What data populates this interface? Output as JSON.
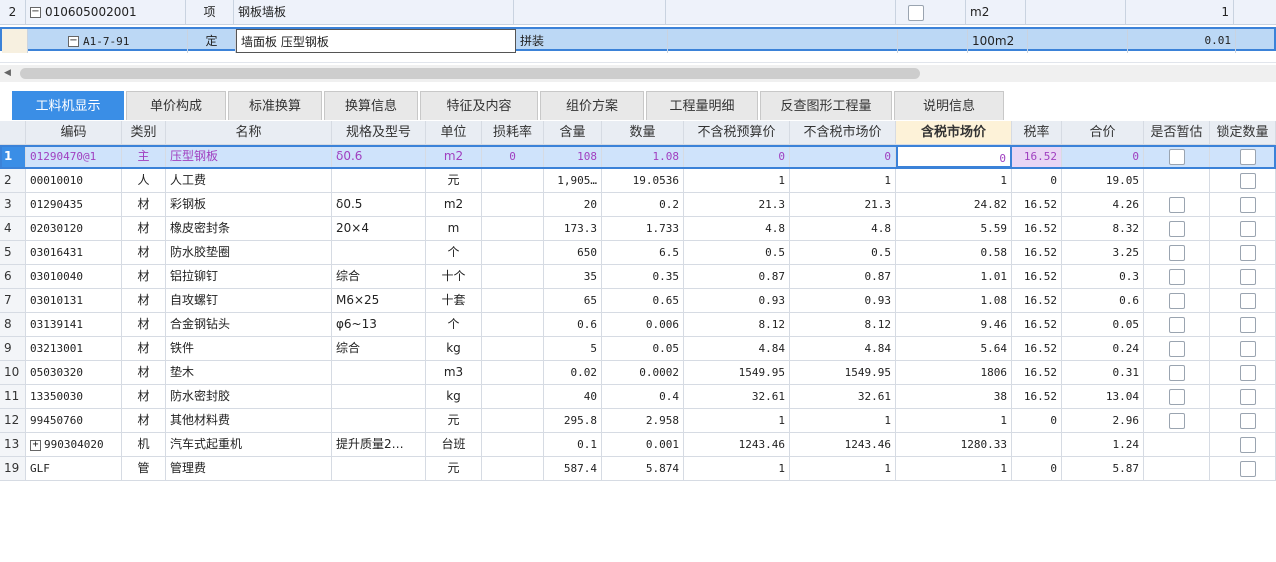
{
  "upper_rows": [
    {
      "row_num": "2",
      "code": "010605002001",
      "type": "项",
      "name": "钢板墙板",
      "desc": "",
      "unit": "m2",
      "qty": "1"
    },
    {
      "row_num": "",
      "code": "A1-7-91",
      "type": "定",
      "name": "墙面板 压型钢板",
      "desc": "拼装",
      "unit": "100m2",
      "qty": "0.01"
    }
  ],
  "tabs": [
    "工料机显示",
    "单价构成",
    "标准换算",
    "换算信息",
    "特征及内容",
    "组价方案",
    "工程量明细",
    "反查图形工程量",
    "说明信息"
  ],
  "columns": [
    "编码",
    "类别",
    "名称",
    "规格及型号",
    "单位",
    "损耗率",
    "含量",
    "数量",
    "不含税预算价",
    "不含税市场价",
    "含税市场价",
    "税率",
    "合价",
    "是否暂估",
    "锁定数量"
  ],
  "rows": [
    {
      "n": "1",
      "code": "01290470@1",
      "cat": "主",
      "name": "压型钢板",
      "spec": "δ0.6",
      "unit": "m2",
      "loss": "0",
      "content": "108",
      "qty": "1.08",
      "budget": "0",
      "market": "0",
      "tax_market": "0",
      "rate": "16.52",
      "total": "0",
      "est": true,
      "lock": true
    },
    {
      "n": "2",
      "code": "00010010",
      "cat": "人",
      "name": "人工费",
      "spec": "",
      "unit": "元",
      "loss": "",
      "content": "1,905…",
      "qty": "19.0536",
      "budget": "1",
      "market": "1",
      "tax_market": "1",
      "rate": "0",
      "total": "19.05",
      "est": false,
      "lock": true
    },
    {
      "n": "3",
      "code": "01290435",
      "cat": "材",
      "name": "彩钢板",
      "spec": "δ0.5",
      "unit": "m2",
      "loss": "",
      "content": "20",
      "qty": "0.2",
      "budget": "21.3",
      "market": "21.3",
      "tax_market": "24.82",
      "rate": "16.52",
      "total": "4.26",
      "est": true,
      "lock": true
    },
    {
      "n": "4",
      "code": "02030120",
      "cat": "材",
      "name": "橡皮密封条",
      "spec": "20×4",
      "unit": "m",
      "loss": "",
      "content": "173.3",
      "qty": "1.733",
      "budget": "4.8",
      "market": "4.8",
      "tax_market": "5.59",
      "rate": "16.52",
      "total": "8.32",
      "est": true,
      "lock": true
    },
    {
      "n": "5",
      "code": "03016431",
      "cat": "材",
      "name": "防水胶垫圈",
      "spec": "",
      "unit": "个",
      "loss": "",
      "content": "650",
      "qty": "6.5",
      "budget": "0.5",
      "market": "0.5",
      "tax_market": "0.58",
      "rate": "16.52",
      "total": "3.25",
      "est": true,
      "lock": true
    },
    {
      "n": "6",
      "code": "03010040",
      "cat": "材",
      "name": "铝拉铆钉",
      "spec": "综合",
      "unit": "十个",
      "loss": "",
      "content": "35",
      "qty": "0.35",
      "budget": "0.87",
      "market": "0.87",
      "tax_market": "1.01",
      "rate": "16.52",
      "total": "0.3",
      "est": true,
      "lock": true
    },
    {
      "n": "7",
      "code": "03010131",
      "cat": "材",
      "name": "自攻螺钉",
      "spec": "M6×25",
      "unit": "十套",
      "loss": "",
      "content": "65",
      "qty": "0.65",
      "budget": "0.93",
      "market": "0.93",
      "tax_market": "1.08",
      "rate": "16.52",
      "total": "0.6",
      "est": true,
      "lock": true
    },
    {
      "n": "8",
      "code": "03139141",
      "cat": "材",
      "name": "合金钢钻头",
      "spec": "φ6~13",
      "unit": "个",
      "loss": "",
      "content": "0.6",
      "qty": "0.006",
      "budget": "8.12",
      "market": "8.12",
      "tax_market": "9.46",
      "rate": "16.52",
      "total": "0.05",
      "est": true,
      "lock": true
    },
    {
      "n": "9",
      "code": "03213001",
      "cat": "材",
      "name": "铁件",
      "spec": "综合",
      "unit": "kg",
      "loss": "",
      "content": "5",
      "qty": "0.05",
      "budget": "4.84",
      "market": "4.84",
      "tax_market": "5.64",
      "rate": "16.52",
      "total": "0.24",
      "est": true,
      "lock": true
    },
    {
      "n": "10",
      "code": "05030320",
      "cat": "材",
      "name": "垫木",
      "spec": "",
      "unit": "m3",
      "loss": "",
      "content": "0.02",
      "qty": "0.0002",
      "budget": "1549.95",
      "market": "1549.95",
      "tax_market": "1806",
      "rate": "16.52",
      "total": "0.31",
      "est": true,
      "lock": true
    },
    {
      "n": "11",
      "code": "13350030",
      "cat": "材",
      "name": "防水密封胶",
      "spec": "",
      "unit": "kg",
      "loss": "",
      "content": "40",
      "qty": "0.4",
      "budget": "32.61",
      "market": "32.61",
      "tax_market": "38",
      "rate": "16.52",
      "total": "13.04",
      "est": true,
      "lock": true
    },
    {
      "n": "12",
      "code": "99450760",
      "cat": "材",
      "name": "其他材料费",
      "spec": "",
      "unit": "元",
      "loss": "",
      "content": "295.8",
      "qty": "2.958",
      "budget": "1",
      "market": "1",
      "tax_market": "1",
      "rate": "0",
      "total": "2.96",
      "est": true,
      "lock": true
    },
    {
      "n": "13",
      "code": "990304020",
      "cat": "机",
      "name": "汽车式起重机",
      "spec": "提升质量2…",
      "unit": "台班",
      "loss": "",
      "content": "0.1",
      "qty": "0.001",
      "budget": "1243.46",
      "market": "1243.46",
      "tax_market": "1280.33",
      "rate": "",
      "total": "1.24",
      "est": false,
      "lock": true,
      "expandable": true
    },
    {
      "n": "19",
      "code": "GLF",
      "cat": "管",
      "name": "管理费",
      "spec": "",
      "unit": "元",
      "loss": "",
      "content": "587.4",
      "qty": "5.874",
      "budget": "1",
      "market": "1",
      "tax_market": "1",
      "rate": "0",
      "total": "5.87",
      "est": false,
      "lock": true
    }
  ],
  "colors": {
    "accent": "#3a8ee6",
    "selected_text": "#a040c0",
    "selected_row": "#cfe3fb",
    "header": "#e9edf3"
  }
}
